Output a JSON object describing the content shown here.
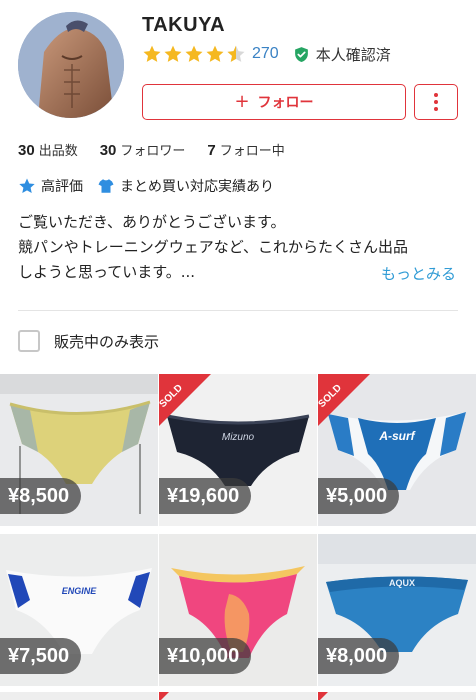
{
  "profile": {
    "username": "TAKUYA",
    "rating_stars": 4.5,
    "rating_count": "270",
    "verified_label": "本人確認済",
    "follow_label": "フォロー",
    "follow_plus": "+"
  },
  "stats": [
    {
      "num": "30",
      "label": "出品数"
    },
    {
      "num": "30",
      "label": "フォロワー"
    },
    {
      "num": "7",
      "label": "フォロー中"
    }
  ],
  "badges": [
    {
      "label": "高評価",
      "icon": "star-badge-icon"
    },
    {
      "label": "まとめ買い対応実績あり",
      "icon": "shirt-badge-icon"
    }
  ],
  "bio": {
    "line1": "ご覧いただき、ありがとうございます。",
    "line2": "競パンやトレーニングウェアなど、これからたくさん出品",
    "line3": "しようと思っています。...",
    "more_label": "もっとみる"
  },
  "filter": {
    "label": "販売中のみ表示",
    "checked": false
  },
  "items": [
    {
      "price": "¥8,500",
      "sold": false
    },
    {
      "price": "¥19,600",
      "sold": true,
      "sold_label": "SOLD",
      "brand_text": "Mizuno"
    },
    {
      "price": "¥5,000",
      "sold": true,
      "sold_label": "SOLD",
      "brand_text": "A-surf"
    },
    {
      "price": "¥7,500",
      "sold": false,
      "brand_text": "ENGINE"
    },
    {
      "price": "¥10,000",
      "sold": false
    },
    {
      "price": "¥8,000",
      "sold": false,
      "brand_text": "AQUX"
    }
  ],
  "colors": {
    "accent_red": "#e0343b",
    "star_gold": "#f5b820",
    "link_blue": "#2f9bd5",
    "rating_blue": "#3a82c4",
    "verified_green": "#26a563"
  }
}
